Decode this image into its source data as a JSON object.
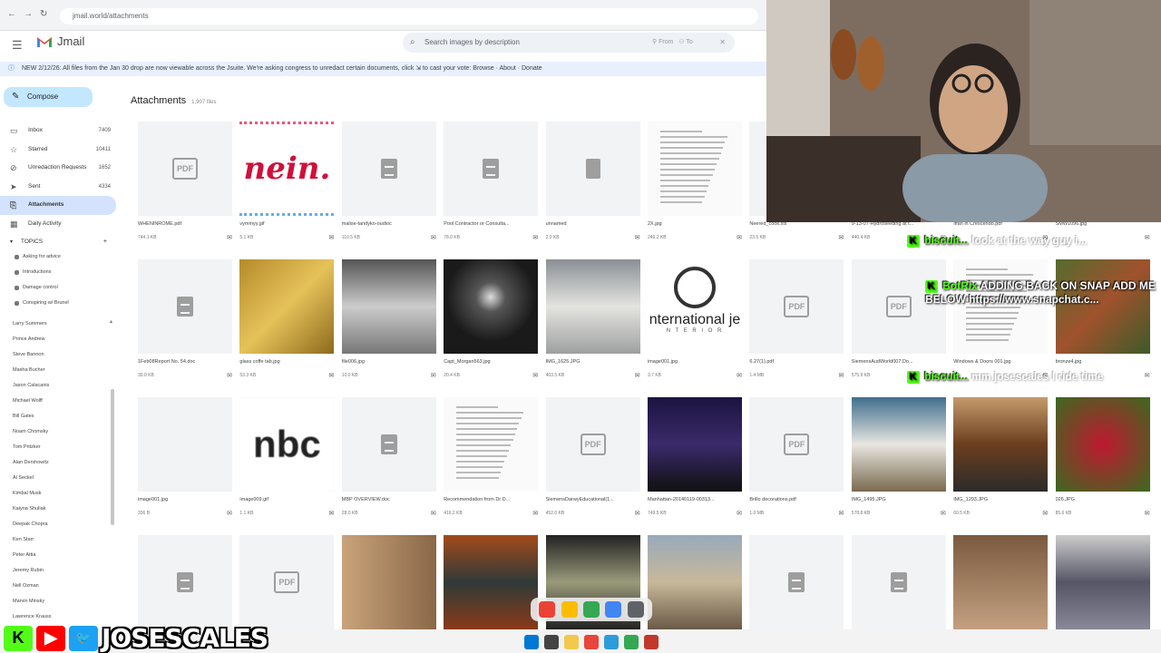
{
  "browser": {
    "url": "jmail.world/attachments",
    "back_icon": "back-arrow-icon",
    "forward_icon": "forward-arrow-icon",
    "reload_icon": "reload-icon"
  },
  "app": {
    "name": "Jmail",
    "menu_icon": "hamburger-menu-icon"
  },
  "search": {
    "placeholder": "Search images by description",
    "filter_from": "From",
    "filter_to": "To"
  },
  "banner": {
    "text": "NEW 2/12/26: All files from the Jan 30 drop are now viewable across the Jsuite. We're asking congress to unredact certain documents, click ⇲ to cast your vote: Browse · About · Donate"
  },
  "sidebar": {
    "compose": "Compose",
    "items": [
      {
        "label": "Inbox",
        "count": "7409",
        "icon": "inbox-icon"
      },
      {
        "label": "Starred",
        "count": "10411",
        "icon": "star-icon"
      },
      {
        "label": "Unredaction Requests",
        "count": "1652",
        "icon": "eye-slash-icon"
      },
      {
        "label": "Sent",
        "count": "4334",
        "icon": "send-icon"
      },
      {
        "label": "Attachments",
        "count": "",
        "icon": "attachment-icon",
        "active": true
      },
      {
        "label": "Daily Activity",
        "count": "",
        "icon": "calendar-icon"
      }
    ],
    "topics_header": "TOPICS",
    "topics": [
      "Asking for advice",
      "Introductions",
      "Damage control",
      "Conspiring w/ Brunel"
    ],
    "people": [
      "Larry Summers",
      "Prince Andrew",
      "Steve Bannon",
      "Masha Bucher",
      "Jason Calacanis",
      "Michael Wolff",
      "Bill Gates",
      "Noam Chomsky",
      "Tom Pritzker",
      "Alan Dershowitz",
      "Al Seckel",
      "Kimbal Musk",
      "Kaiyna Shuliak",
      "Deepak Chopra",
      "Ken Starr",
      "Peter Attia",
      "Jeremy Rubin",
      "Nell Ozman",
      "Marvin Minsky",
      "Lawrence Krauss"
    ]
  },
  "main": {
    "title": "Attachments",
    "count": "1,907 files"
  },
  "files": [
    {
      "name": "WHENINROME.pdf",
      "size": "744.1 KB",
      "kind": "pdf"
    },
    {
      "name": "vymmyy.gif",
      "size": "5.1 KB",
      "kind": "nein"
    },
    {
      "name": "malise-tandyko-oudioc",
      "size": "110.5 KB",
      "kind": "doc"
    },
    {
      "name": "Pool Contractor or Consulta...",
      "size": "78.0 KB",
      "kind": "doc"
    },
    {
      "name": "unnamed",
      "size": "2.0 KB",
      "kind": "file"
    },
    {
      "name": "2X.jpg",
      "size": "246.2 KB",
      "kind": "scan"
    },
    {
      "name": "Neered_cook.xls",
      "size": "23.5 KB",
      "kind": "file"
    },
    {
      "name": "9-13-07-Hydroseeding at t...",
      "size": "440.4 KB",
      "kind": "file"
    },
    {
      "name": "Iffan in Crescendo.pdf",
      "size": "",
      "kind": "pdf"
    },
    {
      "name": "SMW1096.jpg",
      "size": "",
      "kind": "file"
    },
    {
      "name": "1Feb08Report No. 54.doc",
      "size": "30.0 KB",
      "kind": "doc"
    },
    {
      "name": "glass coffe tab.jpg",
      "size": "53.3 KB",
      "kind": "photo-gold"
    },
    {
      "name": "file006.jpg",
      "size": "10.0 KB",
      "kind": "photo-girl"
    },
    {
      "name": "Capt_Morgan563.jpg",
      "size": "20.4 KB",
      "kind": "photo-tunnel"
    },
    {
      "name": "IMG_1625.JPG",
      "size": "403.5 KB",
      "kind": "photo-room"
    },
    {
      "name": "image001.jpg",
      "size": "3.7 KB",
      "kind": "logo-intl"
    },
    {
      "name": "6.27(1).pdf",
      "size": "1.4 MB",
      "kind": "pdf"
    },
    {
      "name": "SiemensAudWorld007.Do...",
      "size": "575.9 KB",
      "kind": "pdf"
    },
    {
      "name": "Windows & Doors 001.jpg",
      "size": "",
      "kind": "scan"
    },
    {
      "name": "bronze4.jpg",
      "size": "",
      "kind": "photo-plant"
    },
    {
      "name": "image001.jpg",
      "size": "336 B",
      "kind": "blank"
    },
    {
      "name": "image009.gif",
      "size": "1.1 KB",
      "kind": "nbc"
    },
    {
      "name": "MBP OVERVIEW.doc",
      "size": "28.0 KB",
      "kind": "doc"
    },
    {
      "name": "Recommendation from Dr D...",
      "size": "416.2 KB",
      "kind": "scan"
    },
    {
      "name": "SiemensDarwyEducational(1...",
      "size": "452.0 KB",
      "kind": "pdf"
    },
    {
      "name": "Manhattan-20140119-00313...",
      "size": "749.5 KB",
      "kind": "photo-couple"
    },
    {
      "name": "Brillo decorations.pdf",
      "size": "1.0 MB",
      "kind": "pdf"
    },
    {
      "name": "IMG_1495.JPG",
      "size": "578.8 KB",
      "kind": "photo-patio"
    },
    {
      "name": "IMG_1293.JPG",
      "size": "60.5 KB",
      "kind": "photo-table"
    },
    {
      "name": "026.JPG",
      "size": "85.6 KB",
      "kind": "photo-flowers"
    },
    {
      "name": "",
      "size": "",
      "kind": "doc"
    },
    {
      "name": "",
      "size": "",
      "kind": "pdf"
    },
    {
      "name": "",
      "size": "",
      "kind": "photo-corner"
    },
    {
      "name": "",
      "size": "",
      "kind": "photo-kitchen"
    },
    {
      "name": "",
      "size": "",
      "kind": "photo-window"
    },
    {
      "name": "",
      "size": "",
      "kind": "photo-building"
    },
    {
      "name": "",
      "size": "",
      "kind": "doc"
    },
    {
      "name": "",
      "size": "",
      "kind": "doc"
    },
    {
      "name": "",
      "size": "",
      "kind": "photo-basement"
    },
    {
      "name": "",
      "size": "",
      "kind": "photo-garage"
    }
  ],
  "tile_text": {
    "nein": "nein.",
    "nbc": "nbc",
    "intl": "nternational je",
    "intl_sub": "N T E R I O R",
    "pdf": "PDF"
  },
  "chat": [
    {
      "user": "biscuit...",
      "text": "look at the way guy i..."
    },
    {
      "user": "BotRix",
      "text": "ADDING BACK ON SNAP ADD ME BELOW https://www.snapchat.c..."
    },
    {
      "user": "biscuit...",
      "text": "mm josescales l ride time"
    }
  ],
  "stream": {
    "handle": "JOSESCALES",
    "kick": "K",
    "youtube": "▶",
    "twitter": "🐦"
  },
  "colors": {
    "accent": "#1a73e8",
    "compose": "#c2e7ff",
    "active": "#d3e3fd",
    "kick": "#53fc18"
  }
}
